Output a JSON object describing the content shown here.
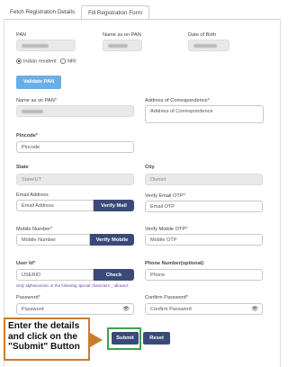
{
  "tabs": [
    {
      "label": "Fetch Registration Details"
    },
    {
      "label": "Fill Registration Form"
    }
  ],
  "pan": {
    "label": "PAN"
  },
  "name_pan": {
    "label": "Name as on PAN"
  },
  "dob": {
    "label": "Date of Birth"
  },
  "residency": {
    "indian": "Indian resident",
    "nri": "NRI"
  },
  "validate_pan": "Validate PAN",
  "name_pan2": {
    "label": "Name as on PAN"
  },
  "address": {
    "label": "Address of Correspondence",
    "placeholder": "Address of Correspondence"
  },
  "pincode": {
    "label": "Pincode",
    "placeholder": "Pincode"
  },
  "state": {
    "label": "State",
    "value": "State/UT"
  },
  "city": {
    "label": "City",
    "value": "District"
  },
  "email": {
    "label": "Email Address",
    "placeholder": "Email Address",
    "verify_label": "Verify Mail"
  },
  "email_otp": {
    "label": "Verify Email OTP",
    "placeholder": "Email OTP"
  },
  "mobile": {
    "label": "Mobile Number",
    "placeholder": "Mobile Number",
    "verify_label": "Verify Mobile"
  },
  "mobile_otp": {
    "label": "Verify Mobile OTP",
    "placeholder": "Mobile OTP"
  },
  "user_id": {
    "label": "User Id",
    "value": "USERID",
    "check_label": "Check",
    "hint": "Only alphanumeric or the following special characters _ allowed"
  },
  "phone": {
    "label": "Phone Number(optional)",
    "placeholder": "Phone"
  },
  "password": {
    "label": "Password",
    "placeholder": "Password"
  },
  "confirm_password": {
    "label": "Confirm Password",
    "placeholder": "Confirm Password"
  },
  "callout": "Enter the details and click on the \"Submit\" Button",
  "submit_label": "Submit",
  "reset_label": "Reset",
  "colors": {
    "primary": "#3a4a78",
    "validate": "#6aaee8",
    "callout_border": "#c87d2c",
    "highlight": "#3aa54a",
    "required": "#d9242c"
  }
}
